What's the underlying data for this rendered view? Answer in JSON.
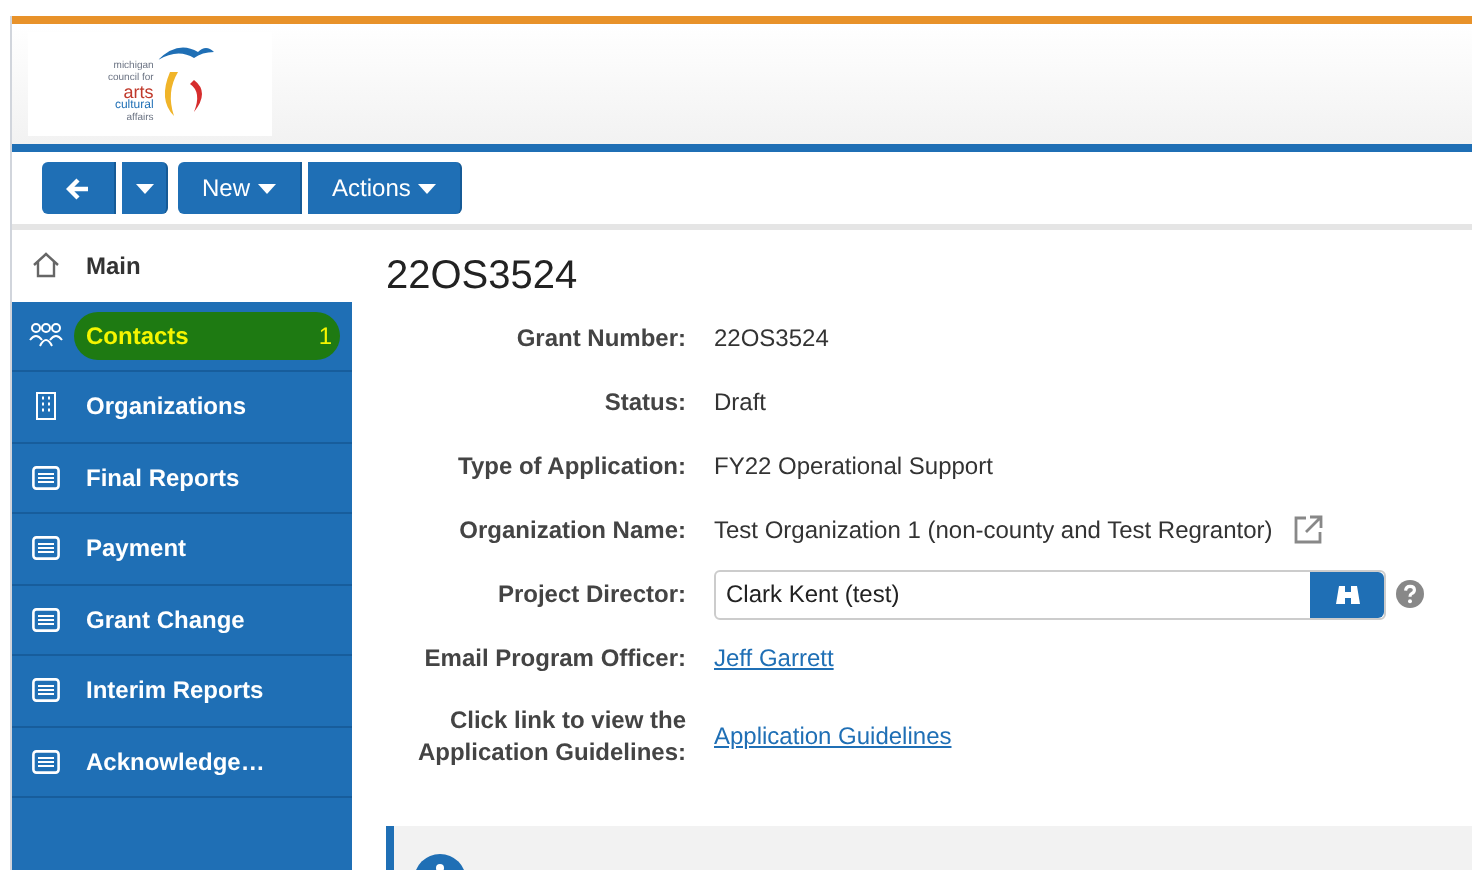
{
  "logo": {
    "lines": [
      "michigan",
      "council for",
      "arts",
      "cultural",
      "affairs"
    ]
  },
  "toolbar": {
    "buttons": [
      {
        "kind": "back"
      },
      {
        "kind": "caret"
      },
      {
        "kind": "menu",
        "label": "New"
      },
      {
        "kind": "menu",
        "label": "Actions"
      }
    ]
  },
  "sidebar": {
    "items": [
      {
        "label": "Main",
        "kind": "plain",
        "selected": false
      },
      {
        "label": "Contacts",
        "kind": "nav",
        "count": "1",
        "selected": true
      },
      {
        "label": "Organizations",
        "kind": "nav",
        "selected": false
      },
      {
        "label": "Final Reports",
        "kind": "nav",
        "selected": false
      },
      {
        "label": "Payment",
        "kind": "nav",
        "selected": false
      },
      {
        "label": "Grant Change",
        "kind": "nav",
        "selected": false
      },
      {
        "label": "Interim Reports",
        "kind": "nav",
        "selected": false
      },
      {
        "label": "Acknowledge…",
        "kind": "nav",
        "selected": false
      }
    ]
  },
  "title": "22OS3524",
  "fields": [
    {
      "label": "Grant Number:",
      "kind": "text",
      "value": "22OS3524"
    },
    {
      "label": "Status:",
      "kind": "text",
      "value": "Draft"
    },
    {
      "label": "Type of Application:",
      "kind": "text",
      "value": "FY22 Operational Support"
    },
    {
      "label": "Organization Name:",
      "kind": "external",
      "value": "Test Organization 1 (non-county and Test Regrantor)"
    },
    {
      "label": "Project Director:",
      "kind": "lookup",
      "value": "Clark Kent (test)"
    },
    {
      "label": "Email Program Officer:",
      "kind": "link",
      "value": "Jeff Garrett"
    },
    {
      "label": "Click link to view the Application Guidelines:",
      "kind": "link",
      "value": "Application Guidelines"
    }
  ],
  "notice": {
    "kind": "info"
  }
}
